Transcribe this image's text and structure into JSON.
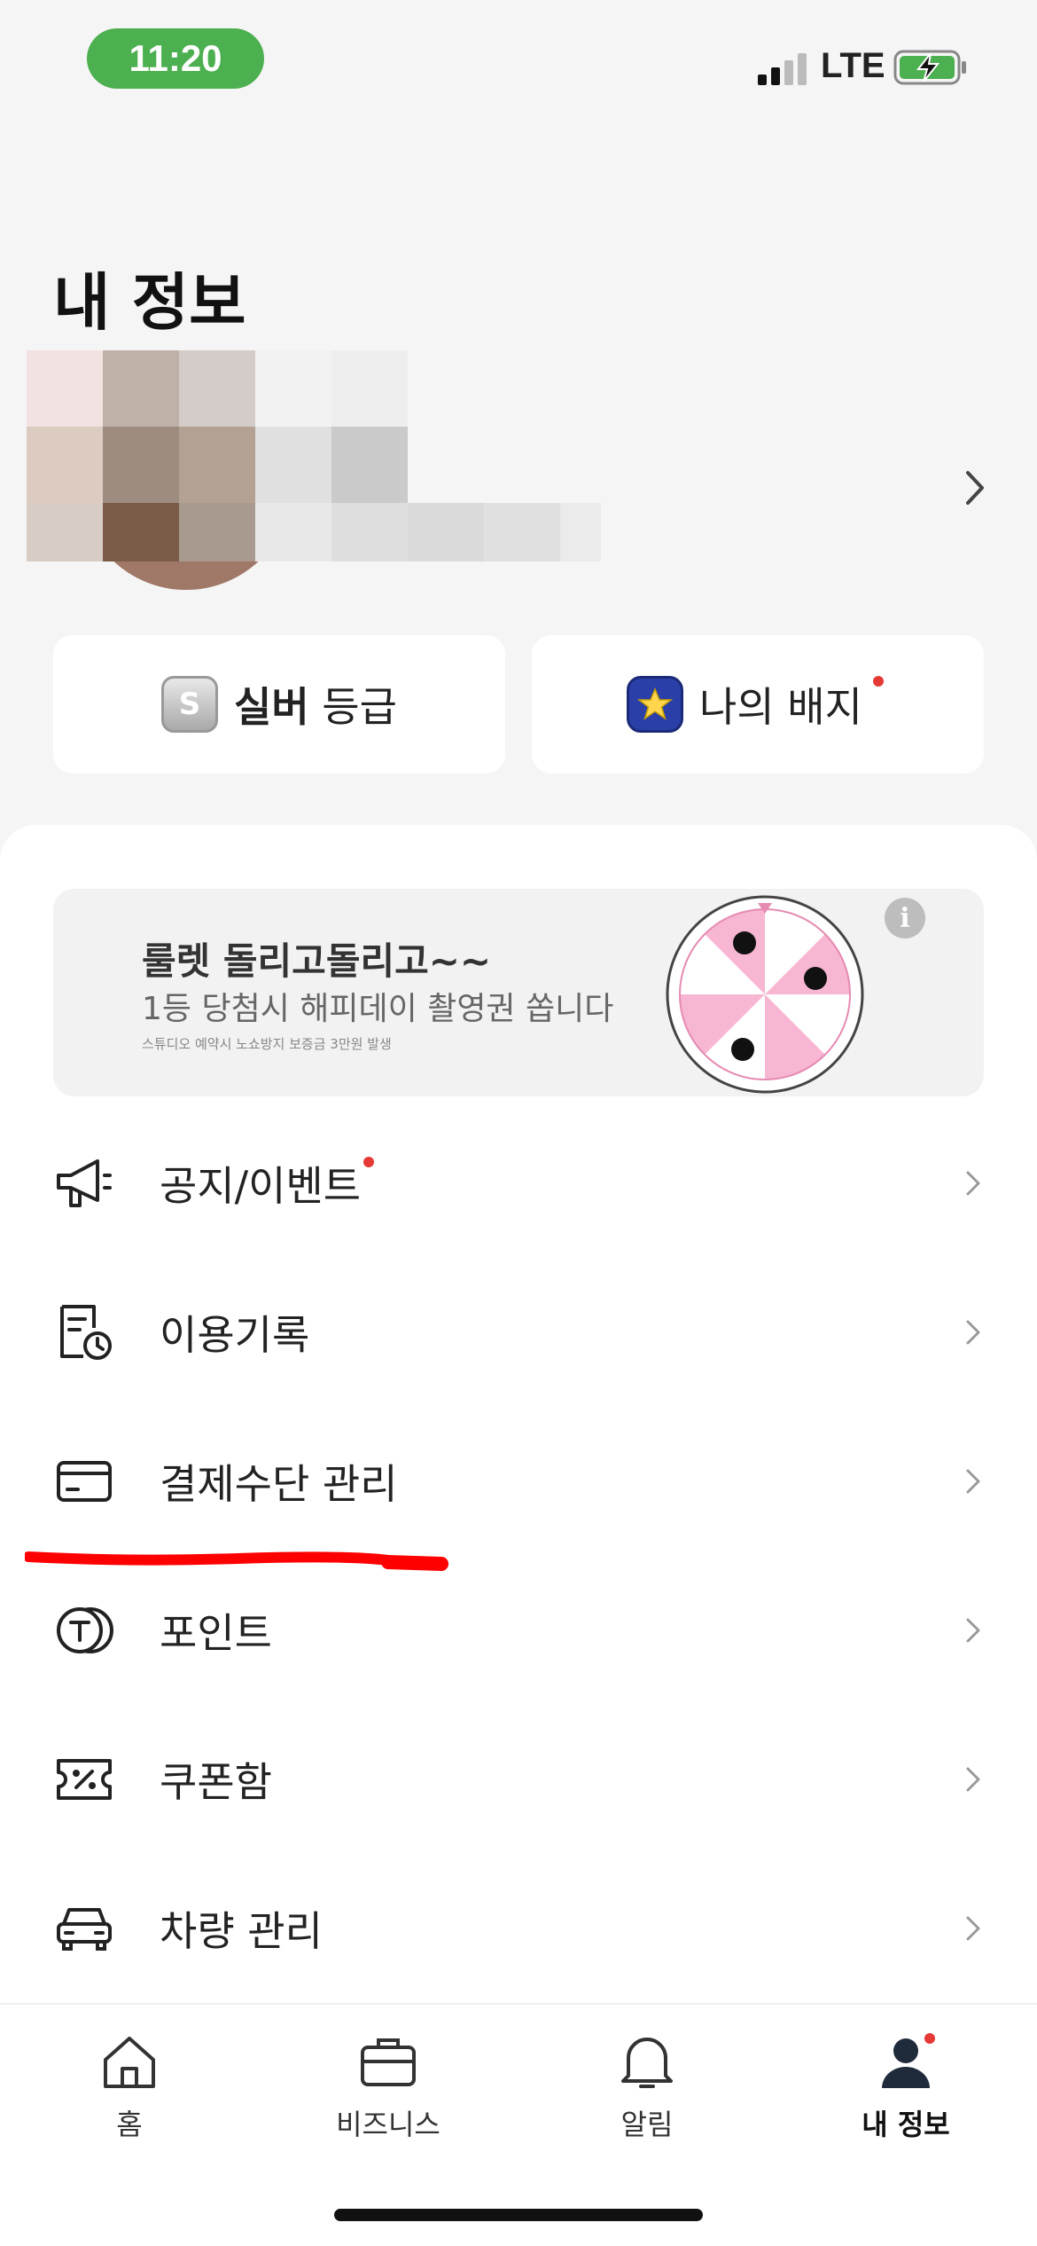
{
  "status_bar": {
    "time": "11:20",
    "network": "LTE"
  },
  "header": {
    "title": "내 정보"
  },
  "profile": {
    "chevron_icon": "chevron-right-icon"
  },
  "grade": {
    "strong": "실버",
    "suffix": " 등급",
    "coin_letter": "S"
  },
  "badge": {
    "label": "나의 배지",
    "has_new": true
  },
  "banner": {
    "title": "룰렛 돌리고돌리고~~",
    "subtitle": "1등 당첨시 해피데이 촬영권 쏩니다",
    "note": "스튜디오 예약시 노쇼방지 보증금 3만원 발생",
    "info_label": "i"
  },
  "menu": {
    "items": [
      {
        "label": "공지/이벤트",
        "icon": "megaphone-icon",
        "has_new": true
      },
      {
        "label": "이용기록",
        "icon": "history-document-icon",
        "has_new": false
      },
      {
        "label": "결제수단 관리",
        "icon": "credit-card-icon",
        "has_new": false
      },
      {
        "label": "포인트",
        "icon": "point-coin-icon",
        "has_new": false
      },
      {
        "label": "쿠폰함",
        "icon": "coupon-icon",
        "has_new": false
      },
      {
        "label": "차량 관리",
        "icon": "car-icon",
        "has_new": false
      }
    ]
  },
  "tabbar": {
    "tabs": [
      {
        "label": "홈",
        "icon": "home-icon",
        "active": false
      },
      {
        "label": "비즈니스",
        "icon": "briefcase-icon",
        "active": false
      },
      {
        "label": "알림",
        "icon": "bell-icon",
        "active": false
      },
      {
        "label": "내 정보",
        "icon": "profile-icon",
        "active": true
      }
    ]
  },
  "colors": {
    "accent_red": "#e53935",
    "status_green": "#4caf50",
    "annotation_red": "#ff0000"
  }
}
